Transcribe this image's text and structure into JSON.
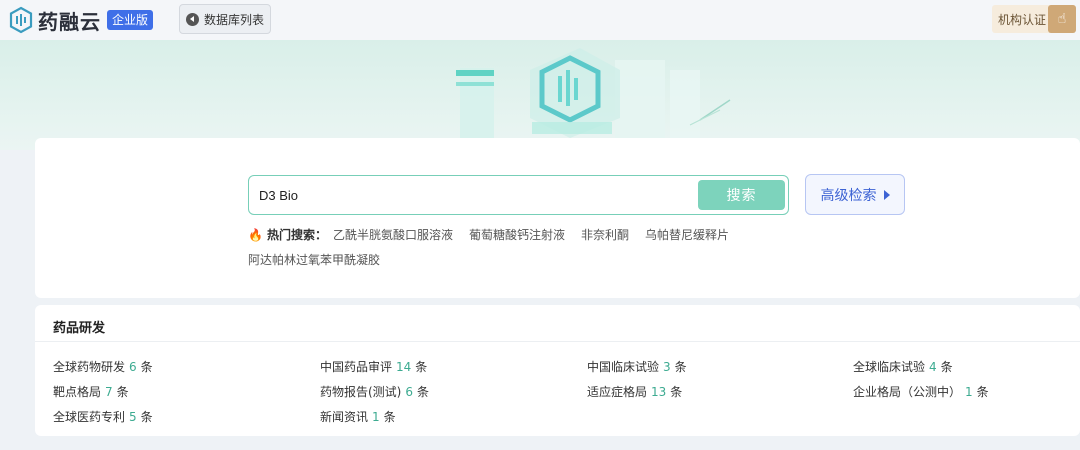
{
  "header": {
    "logo_text": "药融云",
    "logo_badge": "企业版",
    "db_list_label": "数据库列表",
    "cert_label": "机构认证"
  },
  "search": {
    "value": "D3 Bio",
    "button_label": "搜索",
    "advanced_label": "高级检索"
  },
  "hot": {
    "label": "热门搜索：",
    "items": [
      "乙酰半胱氨酸口服溶液",
      "葡萄糖酸钙注射液",
      "非奈利酮",
      "乌帕替尼缓释片",
      "阿达帕林过氧苯甲酰凝胶"
    ]
  },
  "research": {
    "title": "药品研发",
    "unit": "条",
    "items": [
      {
        "label": "全球药物研发",
        "count": "6"
      },
      {
        "label": "中国药品审评",
        "count": "14"
      },
      {
        "label": "中国临床试验",
        "count": "3"
      },
      {
        "label": "全球临床试验",
        "count": "4"
      },
      {
        "label": "靶点格局",
        "count": "7"
      },
      {
        "label": "药物报告(测试)",
        "count": "6"
      },
      {
        "label": "适应症格局",
        "count": "13"
      },
      {
        "label": "企业格局（公测中）",
        "count": "1"
      },
      {
        "label": "全球医药专利",
        "count": "5"
      },
      {
        "label": "新闻资讯",
        "count": "1"
      }
    ]
  },
  "colors": {
    "accent_green": "#7dd3bc",
    "brand_blue": "#3f6fe8",
    "count_green": "#3dab91"
  }
}
